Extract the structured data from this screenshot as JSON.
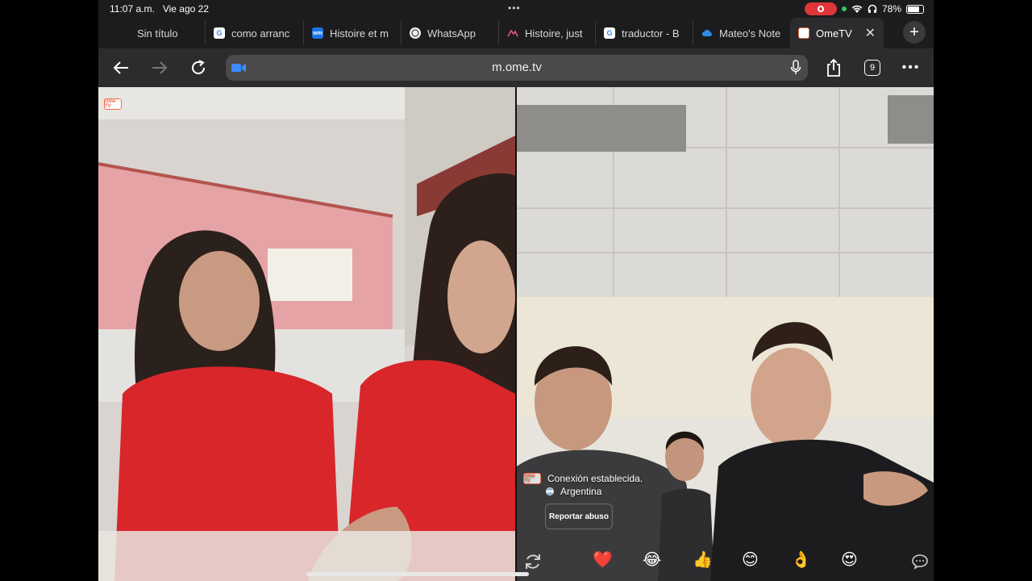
{
  "status": {
    "time": "11:07 a.m.",
    "date": "Vie ago 22",
    "battery_percent": "78%",
    "battery_level": 0.78
  },
  "tabs": [
    {
      "label": "Sin título",
      "icon": "blank-page-icon"
    },
    {
      "label": "como arranc",
      "icon": "google-icon"
    },
    {
      "label": "Histoire et m",
      "icon": "wm-icon"
    },
    {
      "label": "WhatsApp",
      "icon": "whatsapp-icon"
    },
    {
      "label": "Histoire, just",
      "icon": "wiki-icon"
    },
    {
      "label": "traductor - B",
      "icon": "google-icon"
    },
    {
      "label": "Mateo's Note",
      "icon": "onedrive-icon"
    },
    {
      "label": "OmeTV V",
      "icon": "ometv-icon",
      "active": true
    }
  ],
  "toolbar": {
    "url": "m.ome.tv",
    "tab_count": "9"
  },
  "video": {
    "logo_text": "Ome TV",
    "connection_status": "Conexión establecida.",
    "country": "Argentina",
    "report_button": "Reportar abuso"
  },
  "reactions": [
    "❤️",
    "😂",
    "👍",
    "😊",
    "👌",
    "😍"
  ],
  "colors": {
    "accent": "#f36c4a",
    "recording": "#e0363b",
    "status_green": "#34c759"
  }
}
